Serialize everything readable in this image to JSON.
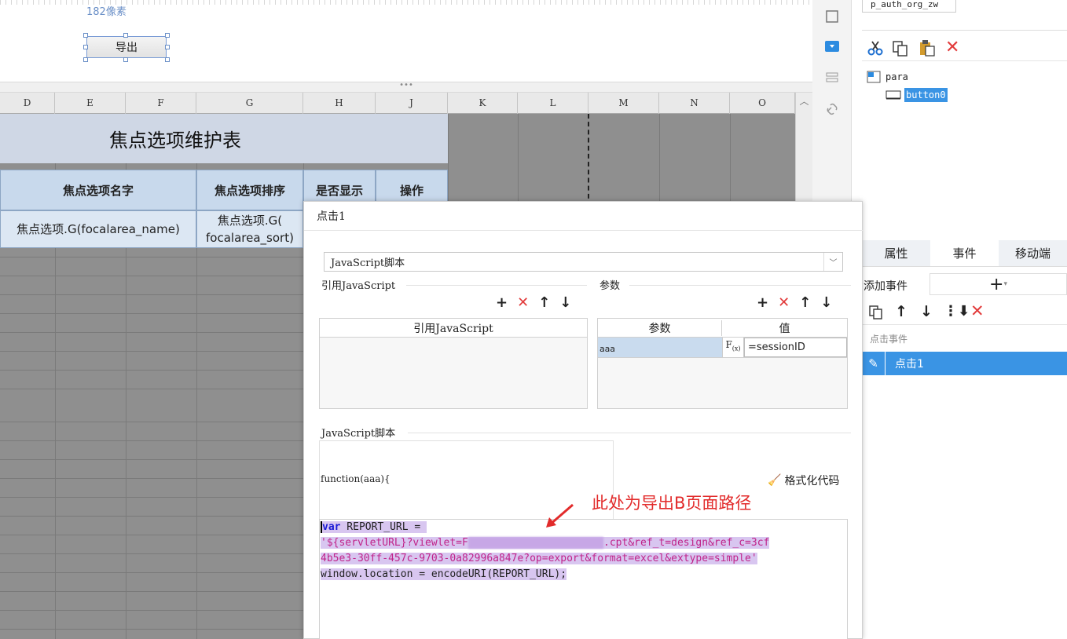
{
  "designer": {
    "px_label": "182像素",
    "export_button": "导出",
    "splitter_dots": "•••"
  },
  "sheet": {
    "columns": [
      "D",
      "E",
      "F",
      "G",
      "H",
      "J",
      "K",
      "L",
      "M",
      "N",
      "O"
    ],
    "title": "焦点选项维护表",
    "headers": [
      "焦点选项名字",
      "焦点选项排序",
      "是否显示",
      "操作"
    ],
    "row1": [
      "焦点选项.G(focalarea_name)",
      "焦点选项.G(\nfocalarea_sort)"
    ]
  },
  "right_panel": {
    "template_name": "p_auth_org_zw",
    "tree_root": "para",
    "tree_child": "button0",
    "tabs": [
      "属性",
      "事件",
      "移动端"
    ],
    "add_event_label": "添加事件",
    "add_event_symbol": "+",
    "event_section": "点击事件",
    "event_item": "点击1"
  },
  "dialog": {
    "title": "点击1",
    "script_type": "JavaScript脚本",
    "ref_section": "引用JavaScript",
    "ref_column": "引用JavaScript",
    "param_section": "参数",
    "param_col_name": "参数",
    "param_col_value": "值",
    "param_name": "aaa",
    "param_value": "=sessionID",
    "script_section": "JavaScript脚本",
    "function_sig": "function(aaa){",
    "format_code": "格式化代码",
    "code": {
      "line1_kw": "var",
      "line1_rest": " REPORT_URL =",
      "line2_start": "'${servletURL}?viewlet=F",
      "line2_end": ".cpt&ref_t=design&ref_c=3cf",
      "line3": "4b5e3-30ff-457c-9703-0a82996a847e?op=export&format=excel&extype=simple'",
      "line4": "window.location = encodeURI(REPORT_URL);"
    },
    "annotation": "此处为导出B页面路径"
  },
  "colors": {
    "accent": "#3a94e4",
    "annotation": "#e22b2b",
    "delete": "#e23b3b",
    "selection": "#d8c6f0"
  }
}
